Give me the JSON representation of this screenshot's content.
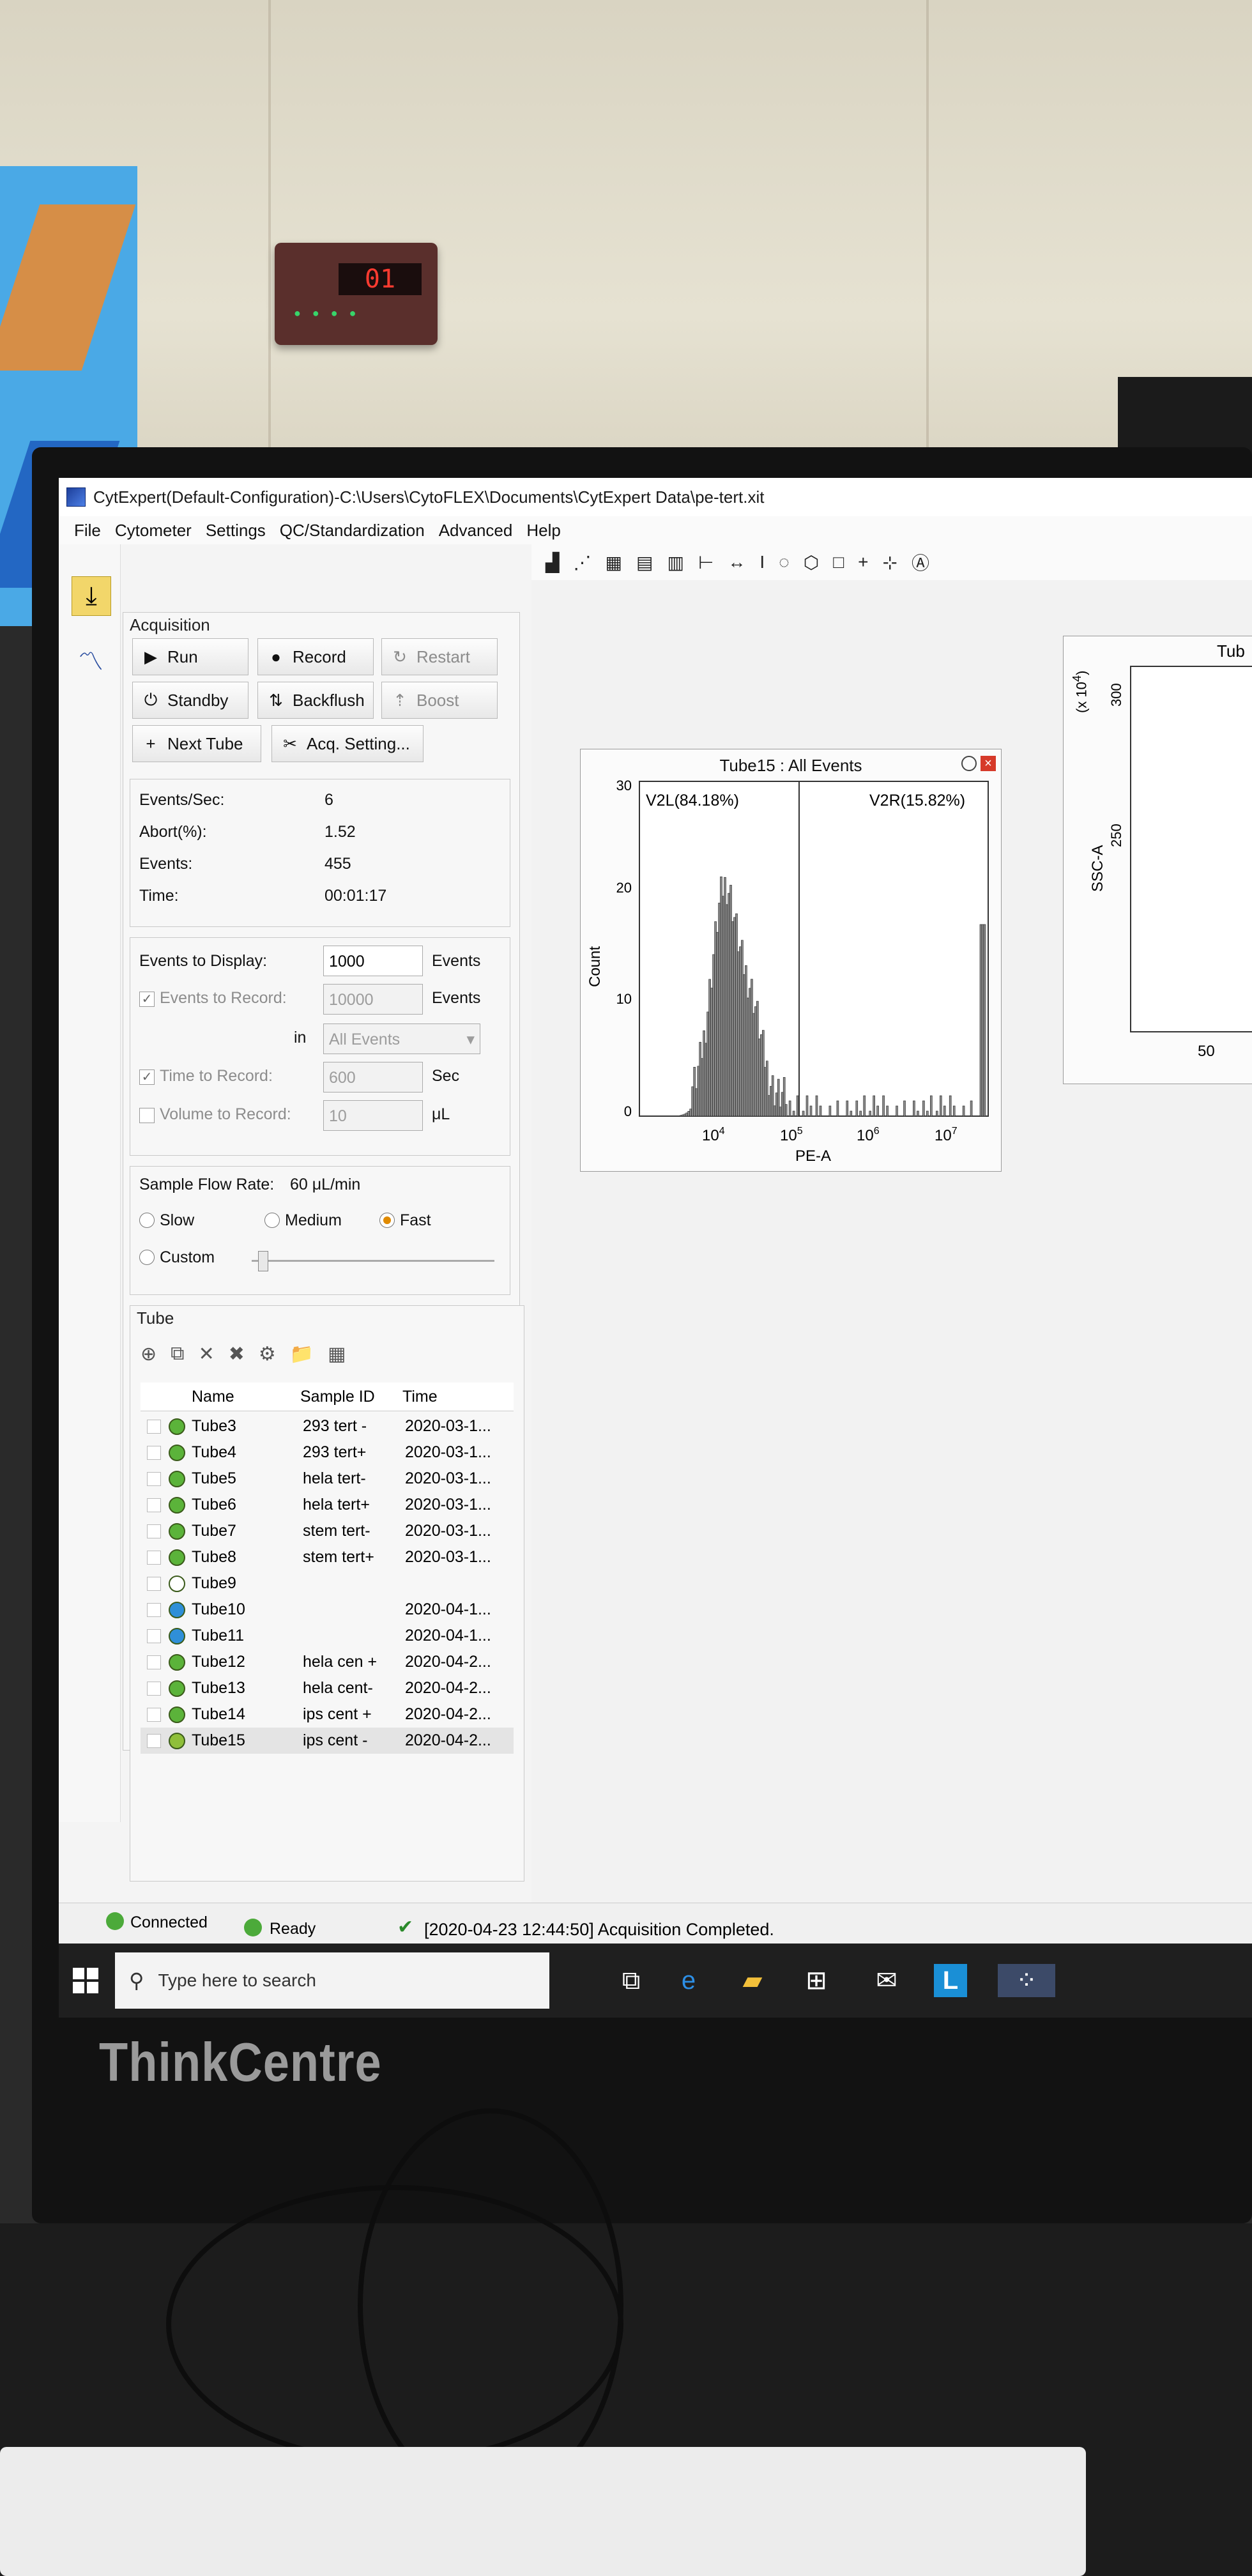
{
  "window": {
    "title": "CytExpert(Default-Configuration)-C:\\Users\\CytoFLEX\\Documents\\CytExpert Data\\pe-tert.xit"
  },
  "menu": [
    "File",
    "Cytometer",
    "Settings",
    "QC/Standardization",
    "Advanced",
    "Help"
  ],
  "acquisition": {
    "title": "Acquisition",
    "buttons": {
      "run": "Run",
      "record": "Record",
      "restart": "Restart",
      "standby": "Standby",
      "backflush": "Backflush",
      "boost": "Boost",
      "next_tube": "Next Tube",
      "acq_setting": "Acq. Setting..."
    },
    "stats": [
      {
        "label": "Events/Sec:",
        "value": "6"
      },
      {
        "label": "Abort(%):",
        "value": "1.52"
      },
      {
        "label": "Events:",
        "value": "455"
      },
      {
        "label": "Time:",
        "value": "00:01:17"
      }
    ],
    "events_to_display": {
      "label": "Events to Display:",
      "value": "1000",
      "unit": "Events"
    },
    "events_to_record": {
      "label": "Events to Record:",
      "value": "10000",
      "unit": "Events",
      "checked": true
    },
    "in": {
      "label": "in",
      "value": "All Events"
    },
    "time_to_record": {
      "label": "Time to Record:",
      "value": "600",
      "unit": "Sec",
      "checked": true
    },
    "volume_to_record": {
      "label": "Volume to Record:",
      "value": "10",
      "unit": "μL",
      "checked": false
    },
    "flow_rate": {
      "label": "Sample Flow Rate:",
      "value": "60 μL/min",
      "options": [
        "Slow",
        "Medium",
        "Fast",
        "Custom"
      ],
      "selected": "Fast"
    }
  },
  "tube_panel": {
    "title": "Tube",
    "columns": [
      "Name",
      "Sample ID",
      "Time"
    ],
    "rows": [
      {
        "name": "Tube3",
        "sample": "293 tert -",
        "time": "2020-03-1...",
        "color": "#5bb33a"
      },
      {
        "name": "Tube4",
        "sample": "293 tert+",
        "time": "2020-03-1...",
        "color": "#5bb33a"
      },
      {
        "name": "Tube5",
        "sample": "hela tert-",
        "time": "2020-03-1...",
        "color": "#5bb33a"
      },
      {
        "name": "Tube6",
        "sample": "hela tert+",
        "time": "2020-03-1...",
        "color": "#5bb33a"
      },
      {
        "name": "Tube7",
        "sample": "stem tert-",
        "time": "2020-03-1...",
        "color": "#5bb33a"
      },
      {
        "name": "Tube8",
        "sample": "stem tert+",
        "time": "2020-03-1...",
        "color": "#5bb33a"
      },
      {
        "name": "Tube9",
        "sample": "",
        "time": "",
        "color": "#ffffff"
      },
      {
        "name": "Tube10",
        "sample": "",
        "time": "2020-04-1...",
        "color": "#2f8fd8"
      },
      {
        "name": "Tube11",
        "sample": "",
        "time": "2020-04-1...",
        "color": "#2f8fd8"
      },
      {
        "name": "Tube12",
        "sample": "hela cen +",
        "time": "2020-04-2...",
        "color": "#5bb33a"
      },
      {
        "name": "Tube13",
        "sample": "hela cent-",
        "time": "2020-04-2...",
        "color": "#5bb33a"
      },
      {
        "name": "Tube14",
        "sample": "ips cent +",
        "time": "2020-04-2...",
        "color": "#5bb33a"
      },
      {
        "name": "Tube15",
        "sample": "ips cent -",
        "time": "2020-04-2...",
        "color": "#8fbf3a"
      }
    ]
  },
  "histogram": {
    "title": "Tube15 : All Events",
    "gate_left": "V2L(84.18%)",
    "gate_right": "V2R(15.82%)",
    "xlabel": "PE-A",
    "ylabel": "Count",
    "yticks": [
      "0",
      "10",
      "20",
      "30"
    ],
    "xticks": [
      "10",
      "10",
      "10",
      "10"
    ],
    "xtick_exp": [
      "4",
      "5",
      "6",
      "7"
    ]
  },
  "second_plot": {
    "title": "Tub",
    "ylabel": "SSC-A",
    "yscale": "(x 10",
    "yscale_exp": "4",
    "yscale_close": ")",
    "yticks": [
      "300",
      "250"
    ],
    "xtick": "50"
  },
  "status": {
    "connected": "Connected",
    "ready": "Ready",
    "message": "[2020-04-23 12:44:50] Acquisition Completed."
  },
  "taskbar": {
    "search_placeholder": "Type here to search",
    "app_letter": "L"
  },
  "clock_display": "01",
  "monitor_brand": "ThinkCentre"
}
